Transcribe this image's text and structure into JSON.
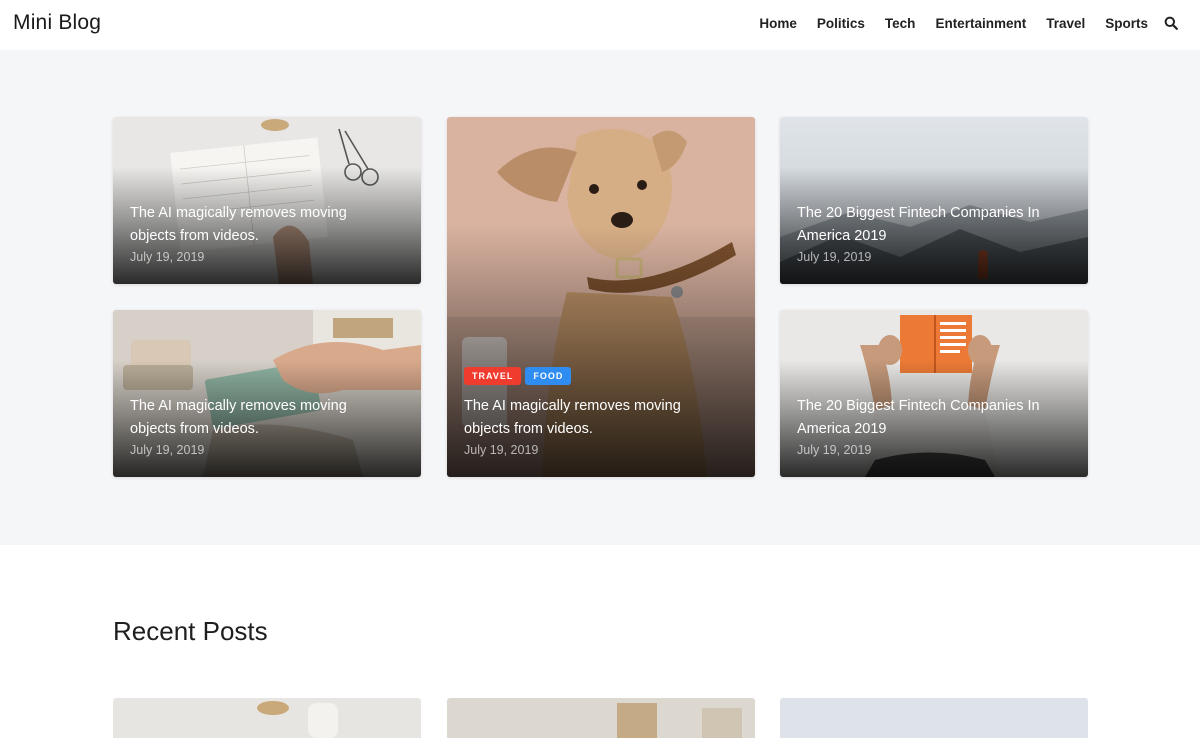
{
  "header": {
    "logo": "Mini Blog",
    "nav": [
      "Home",
      "Politics",
      "Tech",
      "Entertainment",
      "Travel",
      "Sports"
    ],
    "search_icon": "search-icon"
  },
  "featured": [
    {
      "title": "The AI magically removes moving objects from videos.",
      "date": "July 19, 2019"
    },
    {
      "title": "The AI magically removes moving objects from videos.",
      "date": "July 19, 2019"
    },
    {
      "title": "The AI magically removes moving objects from videos.",
      "date": "July 19, 2019",
      "tags": [
        {
          "label": "TRAVEL",
          "color": "#f03b2f"
        },
        {
          "label": "FOOD",
          "color": "#2f8cf0"
        }
      ]
    },
    {
      "title": "The 20 Biggest Fintech Companies In America 2019",
      "date": "July 19, 2019"
    },
    {
      "title": "The 20 Biggest Fintech Companies In America 2019",
      "date": "July 19, 2019"
    }
  ],
  "recent": {
    "heading": "Recent Posts"
  },
  "colors": {
    "hero_bg": "#f5f6f8",
    "tag_travel": "#f03b2f",
    "tag_food": "#2f8cf0"
  }
}
